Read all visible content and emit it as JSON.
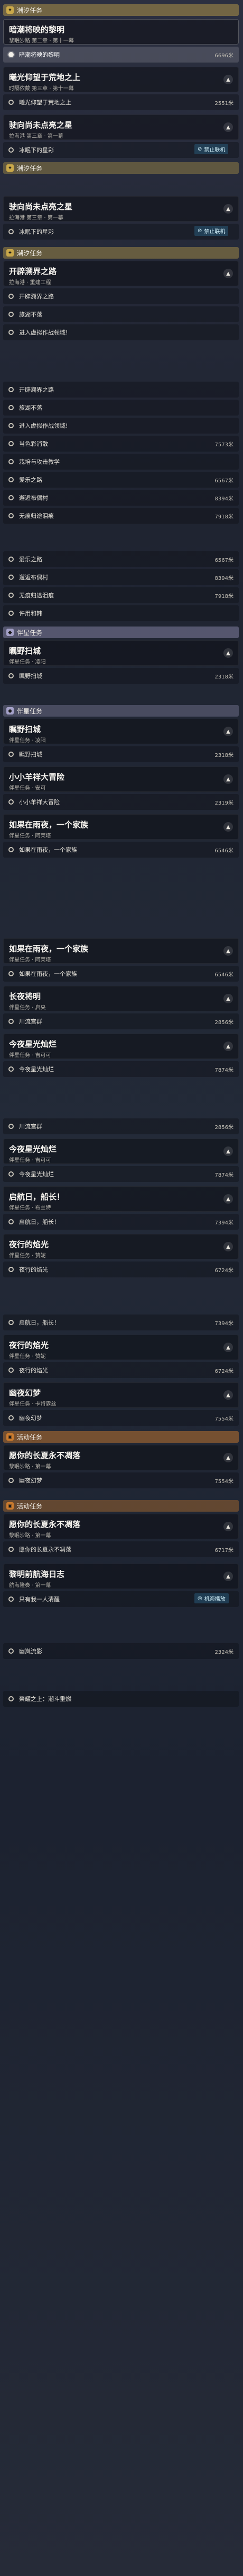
{
  "colors": {
    "section_trailblaze": "#c9a84a",
    "section_companion": "#a4a1c8",
    "section_activity": "#c97a2e"
  },
  "sections": [
    {
      "id": "trailblaze",
      "label": "潮汐任务",
      "icon": "star-badge-icon"
    },
    {
      "id": "trailblaze2",
      "label": "潮汐任务",
      "icon": "star-badge-icon"
    },
    {
      "id": "companion",
      "label": "伴星任务",
      "icon": "companion-badge-icon"
    },
    {
      "id": "companion2",
      "label": "伴星任务",
      "icon": "companion-badge-icon"
    },
    {
      "id": "activity",
      "label": "活动任务",
      "icon": "activity-badge-icon"
    },
    {
      "id": "activity2",
      "label": "活动任务",
      "icon": "activity-badge-icon"
    }
  ],
  "quests": [
    {
      "title": "暗潮将映的黎明",
      "sub": "黎眠沙路 第二章 · 第十一幕"
    },
    {
      "title": "曦光仰望于荒地之上",
      "sub": "时隔依戴 第三章 · 第十一幕"
    },
    {
      "title": "驶向尚未点亮之星",
      "sub": "拉海港 第三章 · 第一幕"
    },
    {
      "title": "驶向尚未点亮之星",
      "sub": "拉海港 第三章 · 第一幕"
    },
    {
      "title": "开辟溯界之路",
      "sub": "拉海港 · 重建工程"
    },
    {
      "title": "瞩野扫城",
      "sub": "伴星任务 · 凌阳"
    },
    {
      "title": "瞩野扫城",
      "sub": "伴星任务 · 凌阳"
    },
    {
      "title": "小小羊祥大冒险",
      "sub": "伴星任务 · 安可"
    },
    {
      "title": "如果在雨夜，一个家族",
      "sub": "伴星任务 · 阿莱塔"
    },
    {
      "title": "如果在雨夜，一个家族",
      "sub": "伴星任务 · 阿莱塔"
    },
    {
      "title": "长夜将明",
      "sub": "伴星任务 · 启央"
    },
    {
      "title": "今夜星光灿烂",
      "sub": "伴星任务 · 吉可可"
    },
    {
      "title": "今夜星光灿烂",
      "sub": "伴星任务 · 吉可可"
    },
    {
      "title": "启航日，船长！",
      "sub": "伴星任务 · 布兰特"
    },
    {
      "title": "夜行的焰光",
      "sub": "伴星任务 · 赞妮"
    },
    {
      "title": "夜行的焰光",
      "sub": "伴星任务 · 赞妮"
    },
    {
      "title": "幽夜幻梦",
      "sub": "伴星任务 · 卡特露丝"
    },
    {
      "title": "愿你的长夏永不凋落",
      "sub": "黎眠沙路 · 第一幕"
    },
    {
      "title": "愿你的长夏永不凋落",
      "sub": "黎眠沙路 · 第一幕"
    },
    {
      "title": "黎明前航海日志",
      "sub": "航海隆奏 · 第一幕"
    }
  ],
  "rows": [
    {
      "label": "暗潮将映的黎明",
      "dist": "6696米"
    },
    {
      "label": "曦光仰望于荒地之上",
      "dist": "2551米"
    },
    {
      "label": "冰眠下的星彩",
      "dist": ""
    },
    {
      "label": "冰眠下的星彩",
      "dist": ""
    },
    {
      "label": "开辟溯界之路",
      "dist": ""
    },
    {
      "label": "旅湖不落",
      "dist": ""
    },
    {
      "label": "进入虚拟作战领域!",
      "dist": ""
    },
    {
      "label": "开辟溯界之路",
      "dist": ""
    },
    {
      "label": "旅湖不落",
      "dist": ""
    },
    {
      "label": "进入虚拟作战领域!",
      "dist": ""
    },
    {
      "label": "当色彩消散",
      "dist": "7573米"
    },
    {
      "label": "栽培与攻击教学",
      "dist": ""
    },
    {
      "label": "爱乐之路",
      "dist": "6567米"
    },
    {
      "label": "邂逅布偶村",
      "dist": "8394米"
    },
    {
      "label": "无痕归途泪痕",
      "dist": "7918米"
    },
    {
      "label": "爱乐之路",
      "dist": "6567米"
    },
    {
      "label": "邂逅布偶村",
      "dist": "8394米"
    },
    {
      "label": "无痕归途泪痕",
      "dist": "7918米"
    },
    {
      "label": "许用和韩",
      "dist": ""
    },
    {
      "label": "瞩野扫城",
      "dist": "2318米"
    },
    {
      "label": "瞩野扫城",
      "dist": "2318米"
    },
    {
      "label": "小小羊祥大冒险",
      "dist": "2319米"
    },
    {
      "label": "如果在雨夜，一个家族",
      "dist": "6546米"
    },
    {
      "label": "如果在雨夜，一个家族",
      "dist": "6546米"
    },
    {
      "label": "川流宫群",
      "dist": "2856米"
    },
    {
      "label": "今夜星光灿烂",
      "dist": "7874米"
    },
    {
      "label": "川流宫群",
      "dist": "2856米"
    },
    {
      "label": "今夜星光灿烂",
      "dist": "7874米"
    },
    {
      "label": "启航日，船长！",
      "dist": "7394米"
    },
    {
      "label": "夜行的焰光",
      "dist": "6724米"
    },
    {
      "label": "启航日，船长！",
      "dist": "7394米"
    },
    {
      "label": "夜行的焰光",
      "dist": "6724米"
    },
    {
      "label": "幽夜幻梦",
      "dist": "7554米"
    },
    {
      "label": "幽夜幻梦",
      "dist": "7554米"
    },
    {
      "label": "愿你的长夏永不凋落",
      "dist": "6717米"
    },
    {
      "label": "只有我一人清醒",
      "dist": ""
    },
    {
      "label": "幽岚流影",
      "dist": "2324米"
    },
    {
      "label": "榮耀之上：潮斗重燃",
      "dist": ""
    }
  ],
  "stamps": [
    {
      "label": "禁止联机",
      "icon": "no-multiplayer-icon"
    },
    {
      "label": "禁止联机",
      "icon": "no-multiplayer-icon"
    },
    {
      "label": "机海播放",
      "icon": "broadcast-icon"
    }
  ]
}
